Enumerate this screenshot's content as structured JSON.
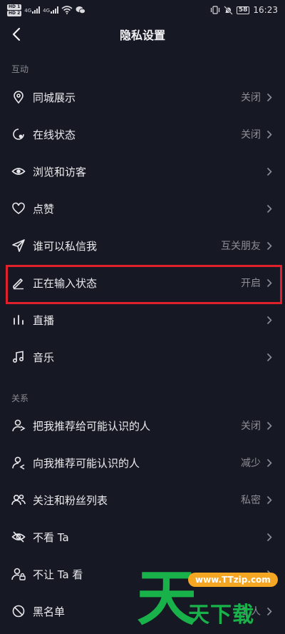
{
  "status_bar": {
    "hd1": "HD 1",
    "hd2": "HD 2",
    "net1": "4G",
    "net2": "4G",
    "battery": "58",
    "time": "16:23"
  },
  "header": {
    "title": "隐私设置",
    "back_icon": "chevron-left-icon"
  },
  "sections": {
    "interaction": "互动",
    "relations": "关系"
  },
  "rows": [
    {
      "label": "同城展示",
      "value": "关闭",
      "icon": "location-pin-icon"
    },
    {
      "label": "在线状态",
      "value": "关闭",
      "icon": "online-status-icon"
    },
    {
      "label": "浏览和访客",
      "value": "",
      "icon": "eye-icon"
    },
    {
      "label": "点赞",
      "value": "",
      "icon": "heart-icon"
    },
    {
      "label": "谁可以私信我",
      "value": "互关朋友",
      "icon": "send-icon"
    },
    {
      "label": "正在输入状态",
      "value": "开启",
      "icon": "pencil-icon"
    },
    {
      "label": "直播",
      "value": "",
      "icon": "live-bars-icon"
    },
    {
      "label": "音乐",
      "value": "",
      "icon": "music-note-icon"
    },
    {
      "label": "把我推荐给可能认识的人",
      "value": "关闭",
      "icon": "user-share-icon"
    },
    {
      "label": "向我推荐可能认识的人",
      "value": "减少",
      "icon": "user-recommend-icon"
    },
    {
      "label": "关注和粉丝列表",
      "value": "私密",
      "icon": "users-icon"
    },
    {
      "label": "不看 Ta",
      "value": "",
      "icon": "eye-off-icon"
    },
    {
      "label": "不让 Ta 看",
      "value": "",
      "icon": "user-lock-icon"
    },
    {
      "label": "黑名单",
      "value": "1 人",
      "icon": "block-icon"
    }
  ],
  "watermark": {
    "char": "天",
    "url": "www.TTzip.com",
    "sub": "天下载"
  },
  "colors": {
    "background": "#161823",
    "highlight": "#e0202a",
    "watermark_green": "#19b24a",
    "watermark_orange": "#f5a623"
  }
}
